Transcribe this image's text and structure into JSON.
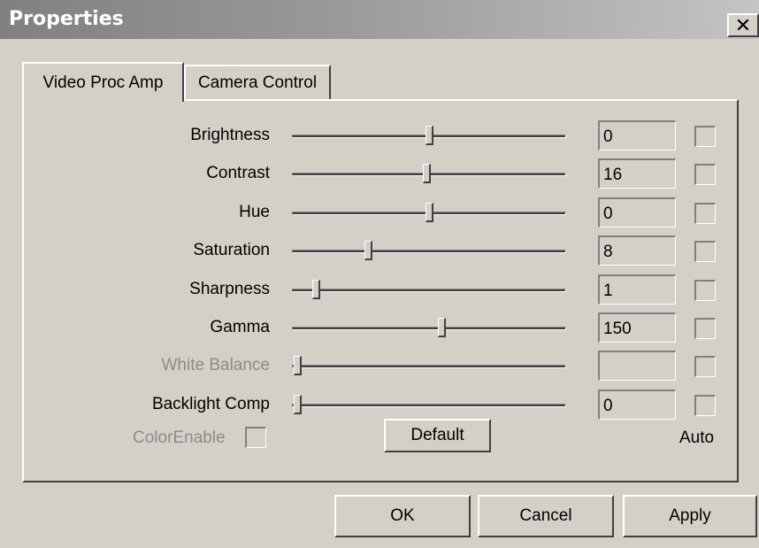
{
  "window": {
    "title": "Properties",
    "close_glyph": "✕"
  },
  "tabs": [
    {
      "label": "Video Proc Amp",
      "active": true
    },
    {
      "label": "Camera Control",
      "active": false
    }
  ],
  "rows": [
    {
      "label": "Brightness",
      "value": "0",
      "slider_fraction": 0.5,
      "disabled": false,
      "auto": false
    },
    {
      "label": "Contrast",
      "value": "16",
      "slider_fraction": 0.49,
      "disabled": false,
      "auto": false
    },
    {
      "label": "Hue",
      "value": "0",
      "slider_fraction": 0.5,
      "disabled": false,
      "auto": false
    },
    {
      "label": "Saturation",
      "value": "8",
      "slider_fraction": 0.27,
      "disabled": false,
      "auto": false
    },
    {
      "label": "Sharpness",
      "value": "1",
      "slider_fraction": 0.07,
      "disabled": false,
      "auto": false
    },
    {
      "label": "Gamma",
      "value": "150",
      "slider_fraction": 0.55,
      "disabled": false,
      "auto": false
    },
    {
      "label": "White Balance",
      "value": "",
      "slider_fraction": 0.0,
      "disabled": true,
      "auto": false
    },
    {
      "label": "Backlight Comp",
      "value": "0",
      "slider_fraction": 0.0,
      "disabled": false,
      "auto": false
    }
  ],
  "color_enable": {
    "label": "ColorEnable",
    "checked": false,
    "disabled": true
  },
  "default_button": "Default",
  "auto_label": "Auto",
  "buttons": {
    "ok": "OK",
    "cancel": "Cancel",
    "apply": "Apply"
  },
  "colors": {
    "face": "#d4d0c8",
    "disabled_text": "#8c8c8c",
    "title_text": "#ffffff"
  }
}
